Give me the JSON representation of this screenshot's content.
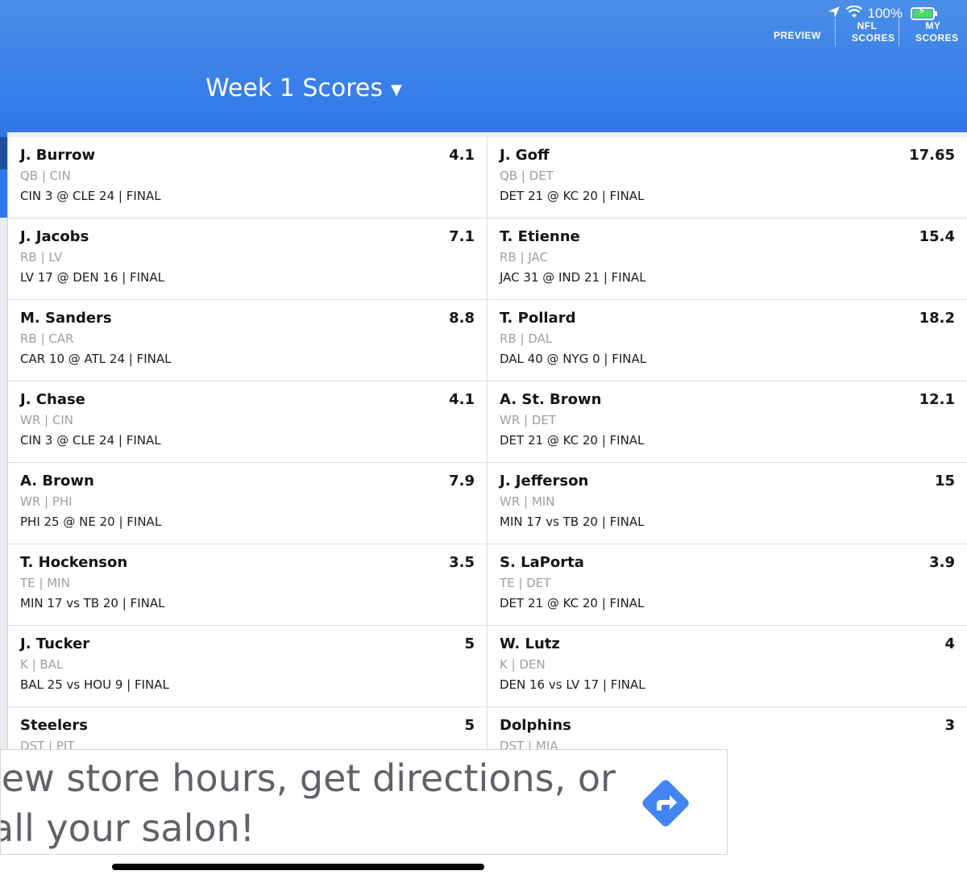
{
  "status": {
    "battery_pct": "100%"
  },
  "nav": {
    "preview": "PREVIEW",
    "nfl_scores_line1": "NFL",
    "nfl_scores_line2": "SCORES",
    "my_scores_line1": "MY",
    "my_scores_line2": "SCORES"
  },
  "title": "Week 1 Scores",
  "rows": [
    {
      "left": {
        "name": "J. Burrow",
        "pts": "4.1",
        "pos": "QB | CIN",
        "game": "CIN 3 @ CLE 24 | FINAL"
      },
      "right": {
        "name": "J. Goff",
        "pts": "17.65",
        "pos": "QB | DET",
        "game": "DET 21 @ KC 20 | FINAL"
      }
    },
    {
      "left": {
        "name": "J. Jacobs",
        "pts": "7.1",
        "pos": "RB | LV",
        "game": "LV 17 @ DEN 16 | FINAL"
      },
      "right": {
        "name": "T. Etienne",
        "pts": "15.4",
        "pos": "RB | JAC",
        "game": "JAC 31 @ IND 21 | FINAL"
      }
    },
    {
      "left": {
        "name": "M. Sanders",
        "pts": "8.8",
        "pos": "RB | CAR",
        "game": "CAR 10 @ ATL 24 | FINAL"
      },
      "right": {
        "name": "T. Pollard",
        "pts": "18.2",
        "pos": "RB | DAL",
        "game": "DAL 40 @ NYG 0 | FINAL"
      }
    },
    {
      "left": {
        "name": "J. Chase",
        "pts": "4.1",
        "pos": "WR | CIN",
        "game": "CIN 3 @ CLE 24 | FINAL"
      },
      "right": {
        "name": "A. St. Brown",
        "pts": "12.1",
        "pos": "WR | DET",
        "game": "DET 21 @ KC 20 | FINAL"
      }
    },
    {
      "left": {
        "name": "A. Brown",
        "pts": "7.9",
        "pos": "WR | PHI",
        "game": "PHI 25 @ NE 20 | FINAL"
      },
      "right": {
        "name": "J. Jefferson",
        "pts": "15",
        "pos": "WR | MIN",
        "game": "MIN 17 vs TB 20 | FINAL"
      }
    },
    {
      "left": {
        "name": "T. Hockenson",
        "pts": "3.5",
        "pos": "TE | MIN",
        "game": "MIN 17 vs TB 20 | FINAL"
      },
      "right": {
        "name": "S. LaPorta",
        "pts": "3.9",
        "pos": "TE | DET",
        "game": "DET 21 @ KC 20 | FINAL"
      }
    },
    {
      "left": {
        "name": "J. Tucker",
        "pts": "5",
        "pos": "K | BAL",
        "game": "BAL 25 vs HOU 9 | FINAL"
      },
      "right": {
        "name": "W. Lutz",
        "pts": "4",
        "pos": "K | DEN",
        "game": "DEN 16 vs LV 17 | FINAL"
      }
    },
    {
      "left": {
        "name": "Steelers",
        "pts": "5",
        "pos": "DST | PIT",
        "game": ""
      },
      "right": {
        "name": "Dolphins",
        "pts": "3",
        "pos": "DST | MIA",
        "game": ""
      }
    }
  ],
  "ad": {
    "line1": "iew store hours, get directions, or",
    "line2": "all your salon!",
    "icon": "directions-icon",
    "icon_color": "#4285f4"
  }
}
